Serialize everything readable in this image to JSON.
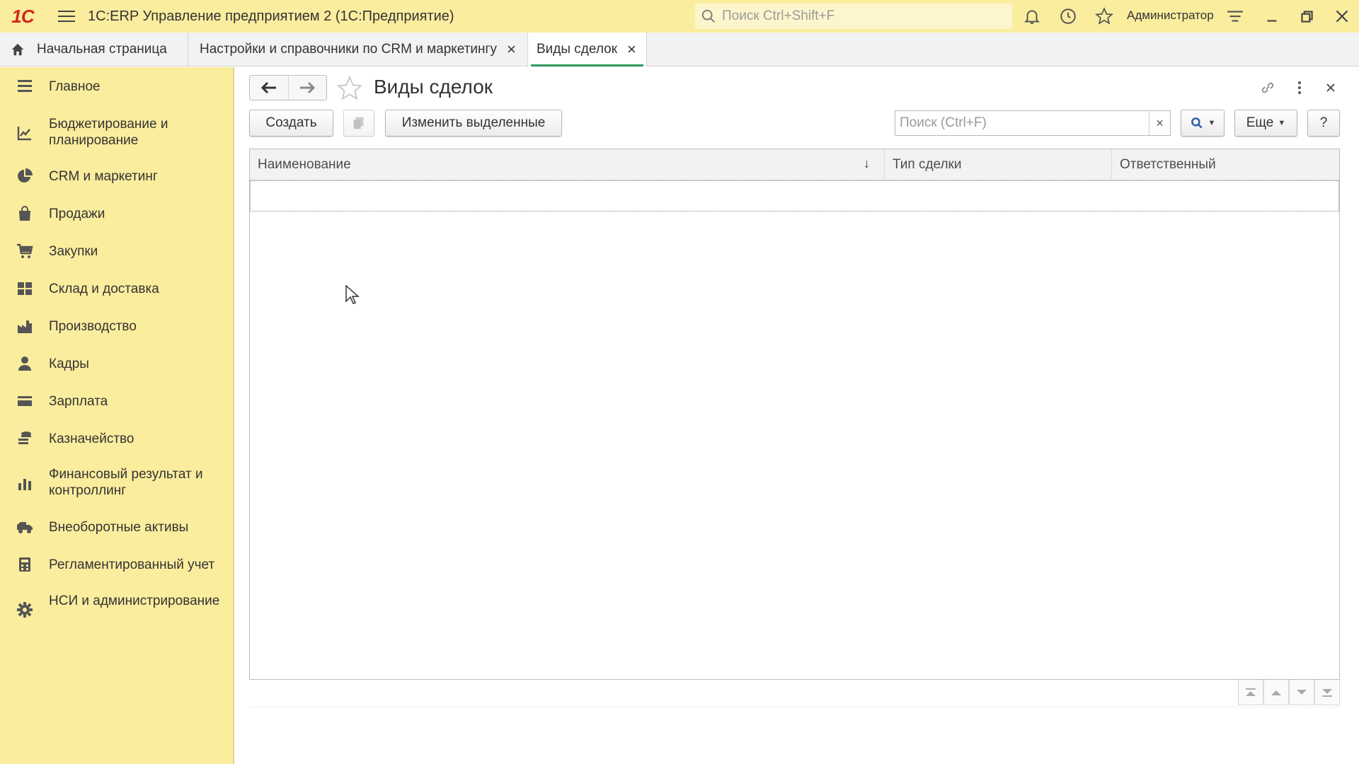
{
  "window": {
    "logo": "1С",
    "title": "1С:ERP Управление предприятием 2  (1С:Предприятие)",
    "search_placeholder": "Поиск Ctrl+Shift+F",
    "user": "Администратор"
  },
  "tabs": {
    "home": "Начальная страница",
    "crm": "Настройки и справочники по CRM и маркетингу",
    "deals": "Виды сделок",
    "close": "×"
  },
  "sidebar": {
    "items": [
      {
        "label": "Главное",
        "icon": "list-icon"
      },
      {
        "label": "Бюджетирование и планирование",
        "icon": "budget-icon"
      },
      {
        "label": "CRM и маркетинг",
        "icon": "pie-chart-icon"
      },
      {
        "label": "Продажи",
        "icon": "shopping-bag-icon"
      },
      {
        "label": "Закупки",
        "icon": "cart-icon"
      },
      {
        "label": "Склад и доставка",
        "icon": "warehouse-icon"
      },
      {
        "label": "Производство",
        "icon": "factory-icon"
      },
      {
        "label": "Кадры",
        "icon": "person-icon"
      },
      {
        "label": "Зарплата",
        "icon": "card-icon"
      },
      {
        "label": "Казначейство",
        "icon": "coins-icon"
      },
      {
        "label": "Финансовый результат и контроллинг",
        "icon": "bar-chart-icon"
      },
      {
        "label": "Внеоборотные активы",
        "icon": "truck-icon"
      },
      {
        "label": "Регламентированный учет",
        "icon": "calculator-icon"
      },
      {
        "label": "НСИ и администрирование",
        "icon": "gear-icon"
      }
    ]
  },
  "form": {
    "title": "Виды сделок",
    "create_label": "Создать",
    "edit_selected_label": "Изменить выделенные",
    "search_placeholder": "Поиск (Ctrl+F)",
    "clear": "×",
    "more_label": "Еще",
    "help_label": "?"
  },
  "table": {
    "columns": [
      "Наименование",
      "Тип сделки",
      "Ответственный"
    ],
    "sort_indicator": "↓",
    "rows": []
  },
  "colors": {
    "titlebar": "#fbed9e",
    "sidebar": "#fbed9e",
    "active_tab_underline": "#2d9a5b",
    "logo": "#d3261a"
  }
}
